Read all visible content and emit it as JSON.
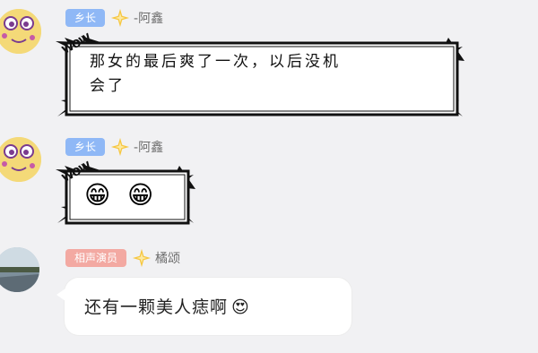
{
  "messages": [
    {
      "badge": "乡长",
      "sender": "-阿鑫",
      "text": "那女的最后爽了一次，以后没机会了",
      "text_lines": [
        "那女的最后爽了一次，以后没机",
        "会了"
      ],
      "sticker": "WOW"
    },
    {
      "badge": "乡长",
      "sender": "-阿鑫",
      "emoji": [
        "😁",
        "😁"
      ],
      "sticker": "WOW"
    },
    {
      "badge": "相声演员",
      "sender": "橘颂",
      "text": "还有一颗美人痣啊",
      "emoji": "😍"
    }
  ],
  "colors": {
    "badge_blue": "#8fb8f6",
    "badge_pink": "#f3a9a2",
    "star": "#f6c742",
    "background": "#f1f1f3"
  },
  "icons": [
    "cartoon-avatar-icon",
    "star-icon",
    "landscape-avatar-icon"
  ]
}
